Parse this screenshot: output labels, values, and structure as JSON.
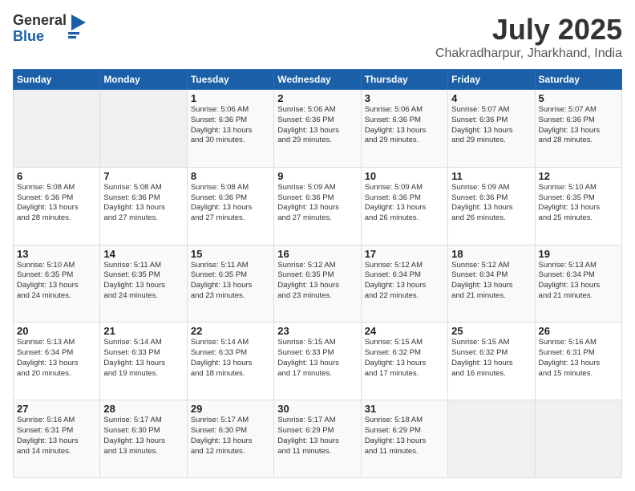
{
  "logo": {
    "general": "General",
    "blue": "Blue"
  },
  "title": {
    "month_year": "July 2025",
    "location": "Chakradharpur, Jharkhand, India"
  },
  "headers": [
    "Sunday",
    "Monday",
    "Tuesday",
    "Wednesday",
    "Thursday",
    "Friday",
    "Saturday"
  ],
  "weeks": [
    [
      {
        "day": "",
        "info": ""
      },
      {
        "day": "",
        "info": ""
      },
      {
        "day": "1",
        "info": "Sunrise: 5:06 AM\nSunset: 6:36 PM\nDaylight: 13 hours\nand 30 minutes."
      },
      {
        "day": "2",
        "info": "Sunrise: 5:06 AM\nSunset: 6:36 PM\nDaylight: 13 hours\nand 29 minutes."
      },
      {
        "day": "3",
        "info": "Sunrise: 5:06 AM\nSunset: 6:36 PM\nDaylight: 13 hours\nand 29 minutes."
      },
      {
        "day": "4",
        "info": "Sunrise: 5:07 AM\nSunset: 6:36 PM\nDaylight: 13 hours\nand 29 minutes."
      },
      {
        "day": "5",
        "info": "Sunrise: 5:07 AM\nSunset: 6:36 PM\nDaylight: 13 hours\nand 28 minutes."
      }
    ],
    [
      {
        "day": "6",
        "info": "Sunrise: 5:08 AM\nSunset: 6:36 PM\nDaylight: 13 hours\nand 28 minutes."
      },
      {
        "day": "7",
        "info": "Sunrise: 5:08 AM\nSunset: 6:36 PM\nDaylight: 13 hours\nand 27 minutes."
      },
      {
        "day": "8",
        "info": "Sunrise: 5:08 AM\nSunset: 6:36 PM\nDaylight: 13 hours\nand 27 minutes."
      },
      {
        "day": "9",
        "info": "Sunrise: 5:09 AM\nSunset: 6:36 PM\nDaylight: 13 hours\nand 27 minutes."
      },
      {
        "day": "10",
        "info": "Sunrise: 5:09 AM\nSunset: 6:36 PM\nDaylight: 13 hours\nand 26 minutes."
      },
      {
        "day": "11",
        "info": "Sunrise: 5:09 AM\nSunset: 6:36 PM\nDaylight: 13 hours\nand 26 minutes."
      },
      {
        "day": "12",
        "info": "Sunrise: 5:10 AM\nSunset: 6:35 PM\nDaylight: 13 hours\nand 25 minutes."
      }
    ],
    [
      {
        "day": "13",
        "info": "Sunrise: 5:10 AM\nSunset: 6:35 PM\nDaylight: 13 hours\nand 24 minutes."
      },
      {
        "day": "14",
        "info": "Sunrise: 5:11 AM\nSunset: 6:35 PM\nDaylight: 13 hours\nand 24 minutes."
      },
      {
        "day": "15",
        "info": "Sunrise: 5:11 AM\nSunset: 6:35 PM\nDaylight: 13 hours\nand 23 minutes."
      },
      {
        "day": "16",
        "info": "Sunrise: 5:12 AM\nSunset: 6:35 PM\nDaylight: 13 hours\nand 23 minutes."
      },
      {
        "day": "17",
        "info": "Sunrise: 5:12 AM\nSunset: 6:34 PM\nDaylight: 13 hours\nand 22 minutes."
      },
      {
        "day": "18",
        "info": "Sunrise: 5:12 AM\nSunset: 6:34 PM\nDaylight: 13 hours\nand 21 minutes."
      },
      {
        "day": "19",
        "info": "Sunrise: 5:13 AM\nSunset: 6:34 PM\nDaylight: 13 hours\nand 21 minutes."
      }
    ],
    [
      {
        "day": "20",
        "info": "Sunrise: 5:13 AM\nSunset: 6:34 PM\nDaylight: 13 hours\nand 20 minutes."
      },
      {
        "day": "21",
        "info": "Sunrise: 5:14 AM\nSunset: 6:33 PM\nDaylight: 13 hours\nand 19 minutes."
      },
      {
        "day": "22",
        "info": "Sunrise: 5:14 AM\nSunset: 6:33 PM\nDaylight: 13 hours\nand 18 minutes."
      },
      {
        "day": "23",
        "info": "Sunrise: 5:15 AM\nSunset: 6:33 PM\nDaylight: 13 hours\nand 17 minutes."
      },
      {
        "day": "24",
        "info": "Sunrise: 5:15 AM\nSunset: 6:32 PM\nDaylight: 13 hours\nand 17 minutes."
      },
      {
        "day": "25",
        "info": "Sunrise: 5:15 AM\nSunset: 6:32 PM\nDaylight: 13 hours\nand 16 minutes."
      },
      {
        "day": "26",
        "info": "Sunrise: 5:16 AM\nSunset: 6:31 PM\nDaylight: 13 hours\nand 15 minutes."
      }
    ],
    [
      {
        "day": "27",
        "info": "Sunrise: 5:16 AM\nSunset: 6:31 PM\nDaylight: 13 hours\nand 14 minutes."
      },
      {
        "day": "28",
        "info": "Sunrise: 5:17 AM\nSunset: 6:30 PM\nDaylight: 13 hours\nand 13 minutes."
      },
      {
        "day": "29",
        "info": "Sunrise: 5:17 AM\nSunset: 6:30 PM\nDaylight: 13 hours\nand 12 minutes."
      },
      {
        "day": "30",
        "info": "Sunrise: 5:17 AM\nSunset: 6:29 PM\nDaylight: 13 hours\nand 11 minutes."
      },
      {
        "day": "31",
        "info": "Sunrise: 5:18 AM\nSunset: 6:29 PM\nDaylight: 13 hours\nand 11 minutes."
      },
      {
        "day": "",
        "info": ""
      },
      {
        "day": "",
        "info": ""
      }
    ]
  ]
}
